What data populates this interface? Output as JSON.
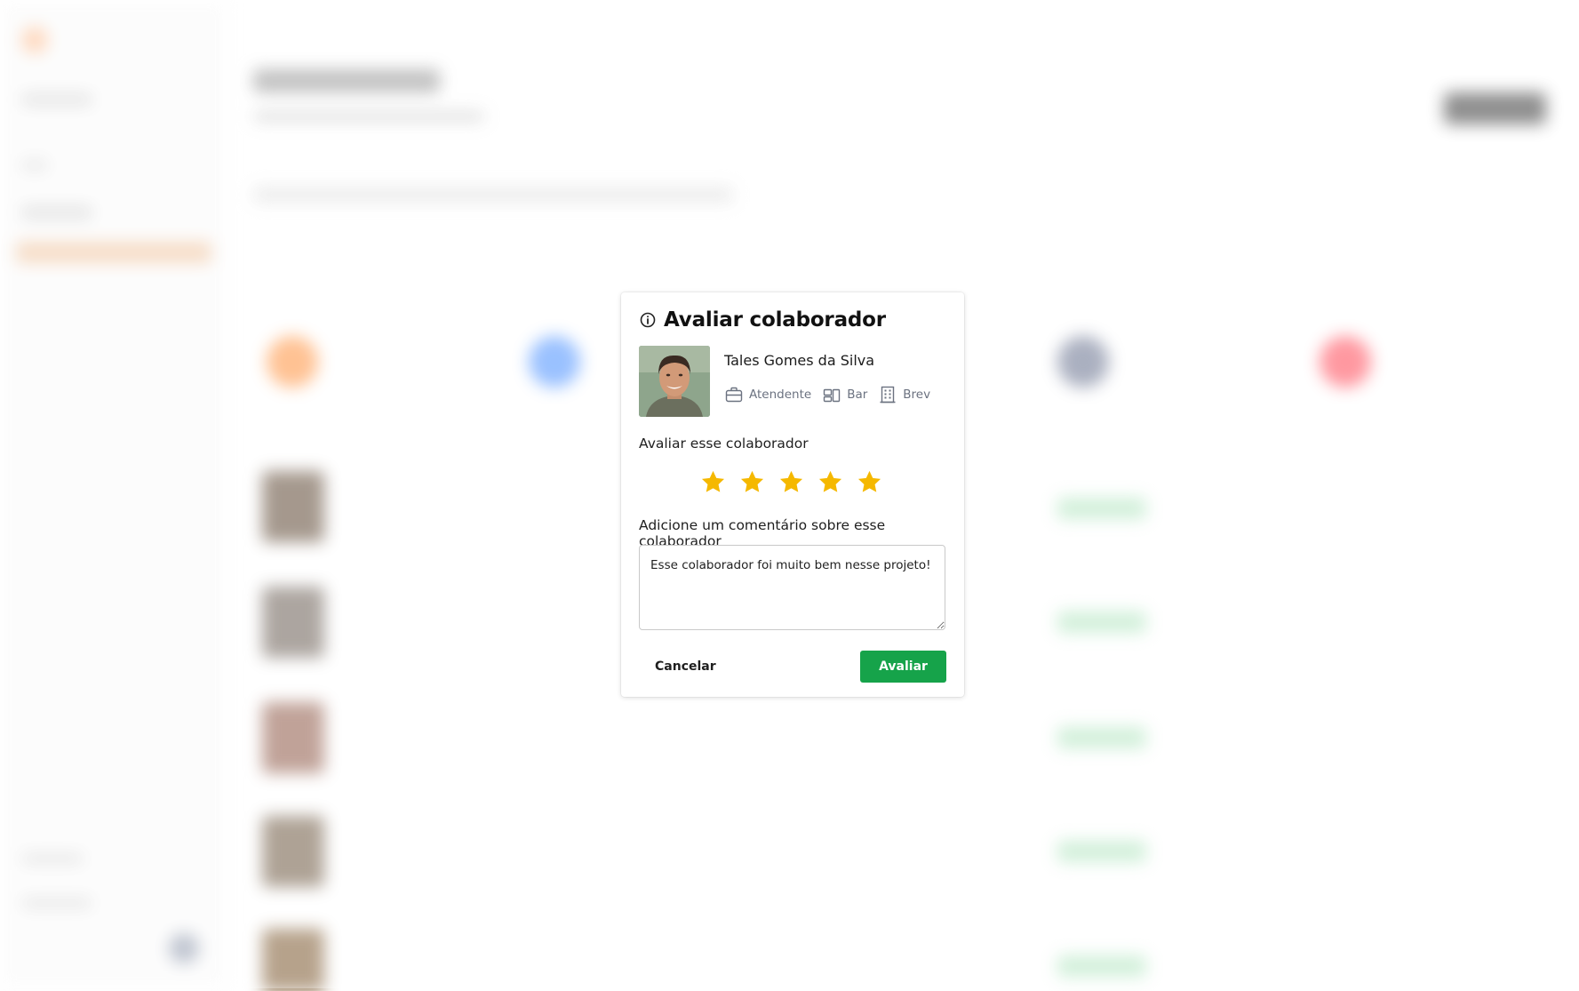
{
  "modal": {
    "title": "Avaliar colaborador",
    "employee": {
      "name": "Tales Gomes da Silva",
      "role": "Atendente",
      "department": "Bar",
      "company": "Brev"
    },
    "rate_label": "Avaliar esse colaborador",
    "rating": {
      "value": 5,
      "max": 5
    },
    "comment_label": "Adicione um comentário sobre esse colaborador",
    "comment_value": "Esse colaborador foi muito bem nesse projeto!",
    "cancel_label": "Cancelar",
    "submit_label": "Avaliar"
  },
  "colors": {
    "accent_green": "#16a34a",
    "star_yellow": "#f5b800",
    "muted_text": "#6b7280"
  },
  "icons": {
    "header": "info-icon",
    "role": "briefcase-icon",
    "department": "department-icon",
    "company": "building-icon",
    "rating": "star-icon"
  }
}
